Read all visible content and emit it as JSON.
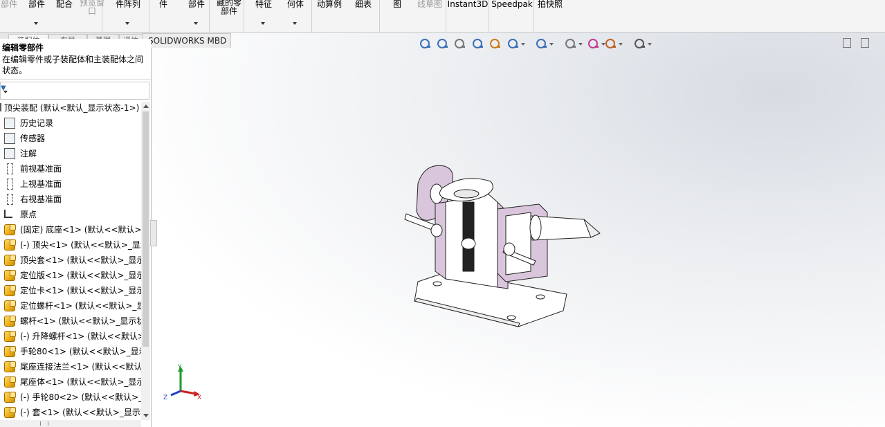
{
  "ribbon": {
    "buttons": [
      {
        "id": "edit-component",
        "label": "编辑零\n部件",
        "dim": true,
        "arrow": false
      },
      {
        "id": "insert-component",
        "label": "插入零\n部件",
        "dim": false,
        "arrow": true
      },
      {
        "id": "mate",
        "label": "配合",
        "dim": false,
        "arrow": false
      },
      {
        "id": "component-preview",
        "label": "零部件\n预览窗\n口",
        "dim": true,
        "arrow": false
      },
      {
        "id": "linear-pattern",
        "label": "线性零部\n件阵列",
        "dim": false,
        "arrow": true
      },
      {
        "id": "smart-fasteners",
        "label": "智能扣\n件",
        "dim": false,
        "arrow": false
      },
      {
        "id": "move-component",
        "label": "移动零\n部件",
        "dim": false,
        "arrow": true
      },
      {
        "id": "show-hidden",
        "label": "显示隐\n藏的零\n部件",
        "dim": false,
        "arrow": false
      },
      {
        "id": "assembly-features",
        "label": "装配体\n特征",
        "dim": false,
        "arrow": true
      },
      {
        "id": "reference-geometry",
        "label": "参考几\n何体",
        "dim": false,
        "arrow": true
      },
      {
        "id": "new-motion-study",
        "label": "新建运\n动算例",
        "dim": false,
        "arrow": false
      },
      {
        "id": "bom",
        "label": "材料明\n细表",
        "dim": false,
        "arrow": false
      },
      {
        "id": "exploded-view",
        "label": "爆炸视\n图",
        "dim": false,
        "arrow": false
      },
      {
        "id": "explode-line",
        "label": "爆炸直\n线草图",
        "dim": true,
        "arrow": false
      },
      {
        "id": "instant3d",
        "label": "Instant3D",
        "dim": false,
        "arrow": false
      },
      {
        "id": "update-speedpak",
        "label": "更新\nSpeedpak",
        "dim": false,
        "arrow": false
      },
      {
        "id": "snapshot",
        "label": "拍快照",
        "dim": false,
        "arrow": false
      }
    ]
  },
  "tabs": {
    "items": [
      "装配体",
      "布局",
      "草图",
      "评估"
    ],
    "mbd": "SOLIDWORKS MBD"
  },
  "tooltip": {
    "title": "编辑零部件",
    "description": "在编辑零件或子装配体和主装配体之间状态。"
  },
  "tree": {
    "root": "顶尖装配  (默认<默认_显示状态-1>)",
    "items": [
      {
        "label": "历史记录",
        "icon": "history-icon"
      },
      {
        "label": "传感器",
        "icon": "sensor-icon"
      },
      {
        "label": "注解",
        "icon": "annotation-icon"
      },
      {
        "label": "前视基准面",
        "icon": "plane-icon"
      },
      {
        "label": "上视基准面",
        "icon": "plane-icon"
      },
      {
        "label": "右视基准面",
        "icon": "plane-icon"
      },
      {
        "label": "原点",
        "icon": "origin-icon"
      },
      {
        "label": "(固定) 底座<1> (默认<<默认>_",
        "icon": "part-icon"
      },
      {
        "label": "(-) 顶尖<1> (默认<<默认>_显示",
        "icon": "part-icon"
      },
      {
        "label": "顶尖套<1> (默认<<默认>_显示",
        "icon": "part-icon"
      },
      {
        "label": "定位版<1> (默认<<默认>_显示",
        "icon": "part-icon"
      },
      {
        "label": "定位卡<1> (默认<<默认>_显示",
        "icon": "part-icon"
      },
      {
        "label": "定位螺杆<1> (默认<<默认>_显",
        "icon": "part-icon"
      },
      {
        "label": "螺杆<1> (默认<<默认>_显示状",
        "icon": "part-icon"
      },
      {
        "label": "(-) 升降螺杆<1> (默认<<默认>",
        "icon": "part-icon"
      },
      {
        "label": "手轮80<1> (默认<<默认>_显示",
        "icon": "part-icon"
      },
      {
        "label": "尾座连接法兰<1> (默认<<默认",
        "icon": "part-icon"
      },
      {
        "label": "尾座体<1> (默认<<默认>_显示",
        "icon": "part-icon"
      },
      {
        "label": "(-) 手轮80<2> (默认<<默认>_显",
        "icon": "part-icon"
      },
      {
        "label": "(-) 套<1> (默认<<默认>_显示状",
        "icon": "part-icon"
      }
    ]
  },
  "viewport": {
    "hud_icons": [
      "zoom-to-fit-icon",
      "zoom-to-area-icon",
      "previous-view-icon",
      "section-view-icon",
      "dynamic-annotation-icon",
      "view-orientation-icon",
      "display-style-icon",
      "hide-show-items-icon",
      "edit-appearance-icon",
      "apply-scene-icon",
      "view-settings-icon"
    ],
    "triad": {
      "x": "X",
      "y": "Y",
      "z": "Z"
    }
  },
  "colors": {
    "part_fill": "#d9c5dc",
    "part_white": "#ffffff",
    "triad_x": "#d11f1f",
    "triad_y": "#1e9a2c",
    "triad_z": "#2140c8"
  }
}
